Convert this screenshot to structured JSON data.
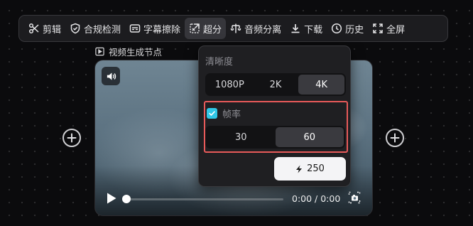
{
  "toolbar": {
    "items": [
      {
        "label": "剪辑",
        "icon": "scissors-icon"
      },
      {
        "label": "合规检测",
        "icon": "shield-check-icon"
      },
      {
        "label": "字幕擦除",
        "icon": "subtitle-icon"
      },
      {
        "label": "超分",
        "icon": "upscale-icon",
        "active": true
      },
      {
        "label": "音频分离",
        "icon": "audio-split-icon"
      },
      {
        "label": "下载",
        "icon": "download-icon"
      },
      {
        "label": "历史",
        "icon": "clock-icon"
      },
      {
        "label": "全屏",
        "icon": "fullscreen-icon"
      }
    ]
  },
  "node": {
    "label": "视频生成节点",
    "icon": "play-square-icon"
  },
  "video": {
    "time_display": "0:00 / 0:00",
    "progress": 0.0
  },
  "panel": {
    "resolution_title": "清晰度",
    "resolution_options": [
      "1080P",
      "2K",
      "4K"
    ],
    "resolution_selected": "4K",
    "fps_title": "帧率",
    "fps_checked": true,
    "fps_options": [
      "30",
      "60"
    ],
    "fps_selected": "60",
    "cost_label": "250",
    "cost_icon": "lightning-icon"
  },
  "colors": {
    "accent_checkbox": "#2fc7e6",
    "highlight_border": "#e85a5a"
  }
}
